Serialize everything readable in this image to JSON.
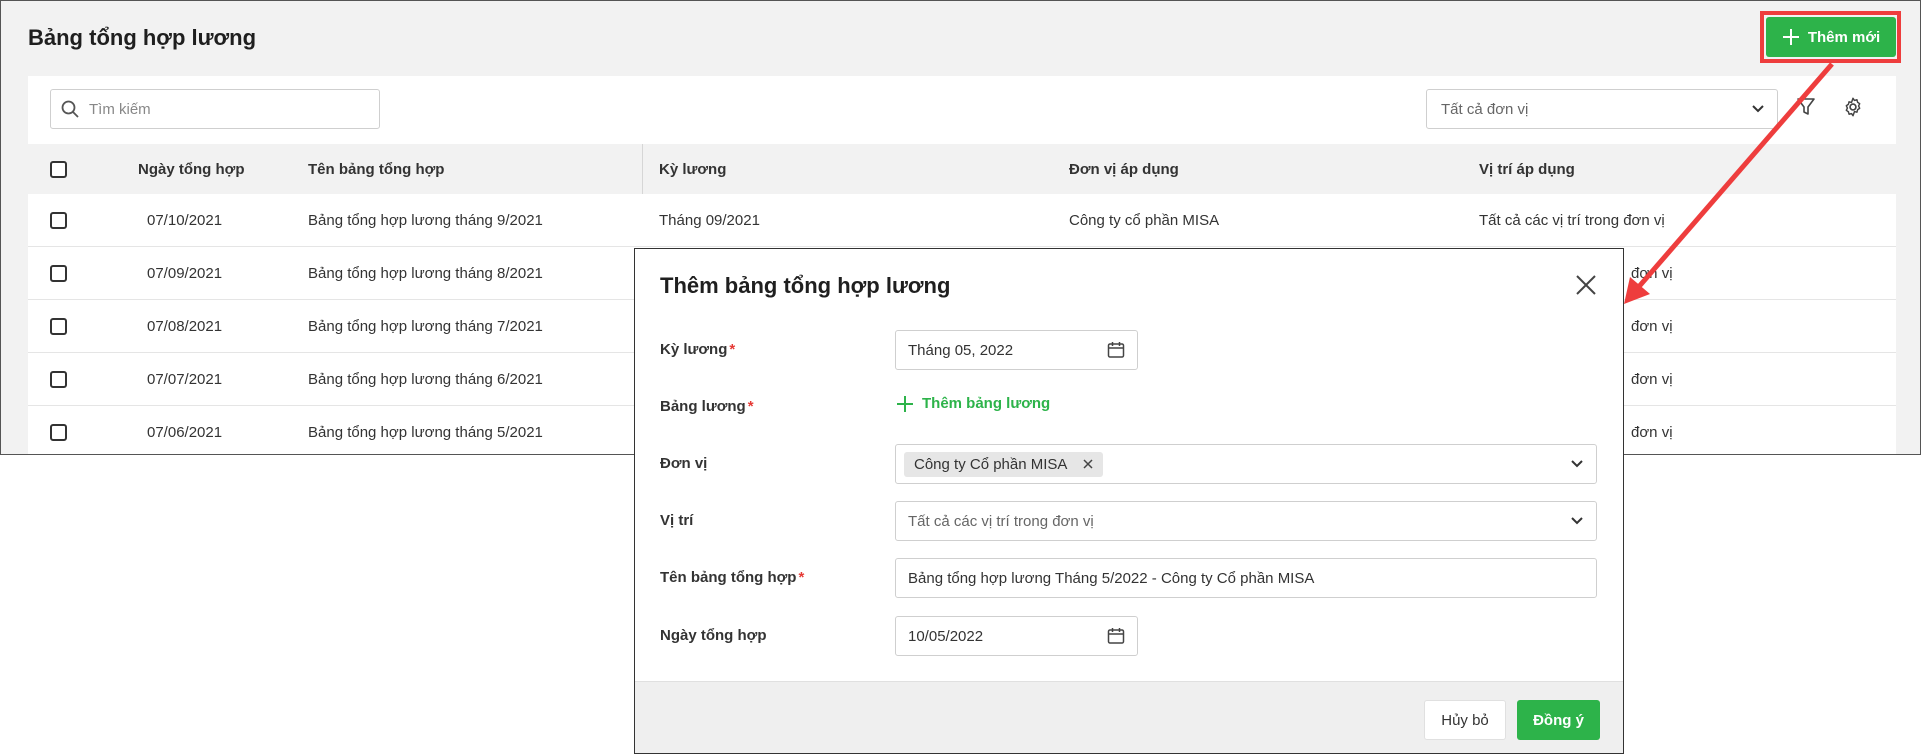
{
  "page": {
    "title": "Bảng tổng hợp lương",
    "add_new_label": "Thêm mới"
  },
  "toolbar": {
    "search_placeholder": "Tìm kiếm",
    "unit_filter_value": "Tất cả đơn vị"
  },
  "table": {
    "headers": [
      "Ngày tổng hợp",
      "Tên bảng tổng hợp",
      "Kỳ lương",
      "Đơn vị áp dụng",
      "Vị trí áp dụng"
    ],
    "rows": [
      {
        "date": "07/10/2021",
        "name": "Bảng tổng hợp lương tháng 9/2021",
        "period": "Tháng 09/2021",
        "unit": "Công ty cổ phần MISA",
        "position": "Tất cả các vị trí trong đơn vị"
      },
      {
        "date": "07/09/2021",
        "name": "Bảng tổng hợp lương tháng 8/2021",
        "period": "",
        "unit": "",
        "position": "đơn vị"
      },
      {
        "date": "07/08/2021",
        "name": "Bảng tổng hợp lương tháng 7/2021",
        "period": "",
        "unit": "",
        "position": "đơn vị"
      },
      {
        "date": "07/07/2021",
        "name": "Bảng tổng hợp lương tháng 6/2021",
        "period": "",
        "unit": "",
        "position": "đơn vị"
      },
      {
        "date": "07/06/2021",
        "name": "Bảng tổng hợp lương tháng 5/2021",
        "period": "",
        "unit": "",
        "position": "đơn vị"
      }
    ]
  },
  "dialog": {
    "title": "Thêm bảng tổng hợp lương",
    "fields": {
      "period": {
        "label": "Kỳ lương",
        "value": "Tháng 05, 2022"
      },
      "salary_table": {
        "label": "Bảng lương",
        "action": "Thêm bảng lương"
      },
      "unit": {
        "label": "Đơn vị",
        "tag": "Công ty Cổ phần MISA"
      },
      "position": {
        "label": "Vị trí",
        "value": "Tất cả các vị trí trong đơn vị"
      },
      "summary_name": {
        "label": "Tên bảng tổng hợp",
        "value": "Bảng tổng hợp lương Tháng 5/2022 - Công ty Cổ phần MISA"
      },
      "summary_date": {
        "label": "Ngày tổng hợp",
        "value": "10/05/2022"
      }
    },
    "required_mark": "*",
    "cancel_label": "Hủy bỏ",
    "ok_label": "Đồng ý"
  },
  "colors": {
    "primary_green": "#2db34a",
    "highlight_red": "#ee3d3d",
    "required_red": "#e53935"
  }
}
